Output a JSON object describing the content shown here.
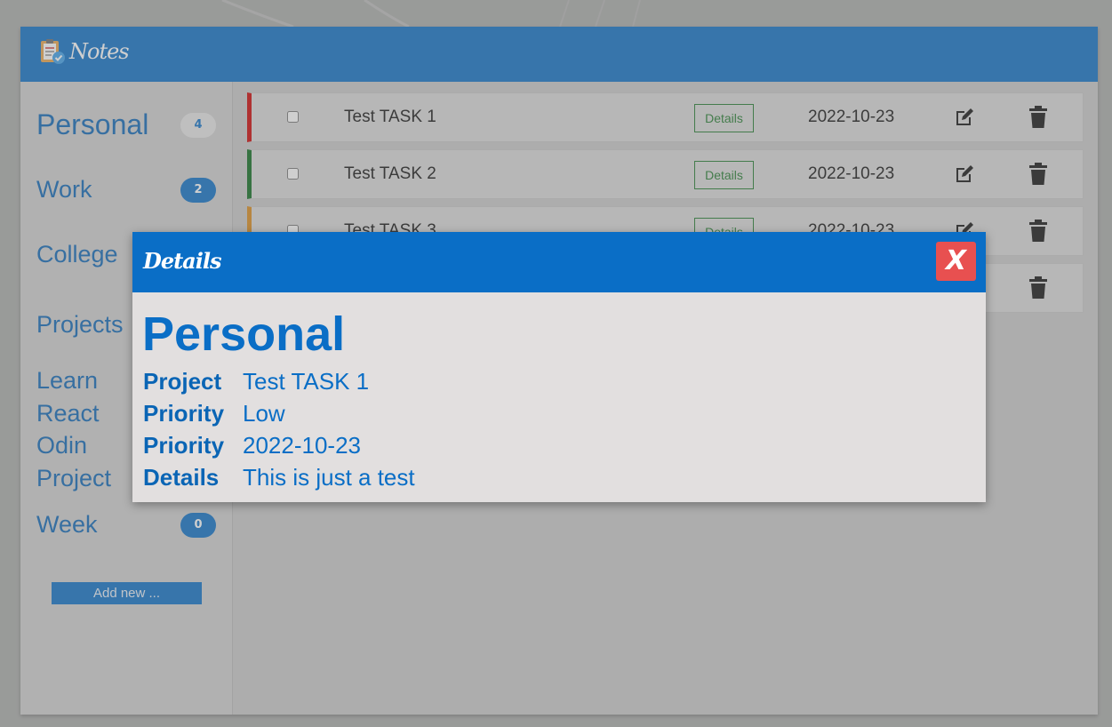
{
  "app": {
    "title": "Notes"
  },
  "sidebar": {
    "categories": [
      {
        "label": "Personal",
        "count": "4"
      },
      {
        "label": "Work",
        "count": "2"
      },
      {
        "label": "College",
        "count": ""
      }
    ],
    "projects_label": "Projects",
    "projects": [
      "Learn",
      "React",
      "Odin",
      "Project"
    ],
    "week": {
      "label": "Week",
      "count": "0"
    },
    "add_new_label": "Add new ..."
  },
  "tasks": [
    {
      "name": "Test TASK 1",
      "details_label": "Details",
      "date": "2022-10-23",
      "priority_color": "#cc0000"
    },
    {
      "name": "Test TASK 2",
      "details_label": "Details",
      "date": "2022-10-23",
      "priority_color": "#0b6b1c"
    },
    {
      "name": "Test TASK 3",
      "details_label": "Details",
      "date": "2022-10-23",
      "priority_color": "#d98a1a"
    },
    {
      "name": "",
      "details_label": "",
      "date": "",
      "priority_color": "#bbbbbb"
    }
  ],
  "modal": {
    "title": "Details",
    "close_label": "X",
    "category": "Personal",
    "rows": [
      {
        "key": "Project",
        "value": "Test TASK 1"
      },
      {
        "key": "Priority",
        "value": "Low"
      },
      {
        "key": "Priority",
        "value": "2022-10-23"
      },
      {
        "key": "Details",
        "value": "This is just a test"
      }
    ]
  },
  "colors": {
    "accent": "#0a6ec6",
    "close": "#e85050",
    "details_green": "#1f7a2c"
  }
}
